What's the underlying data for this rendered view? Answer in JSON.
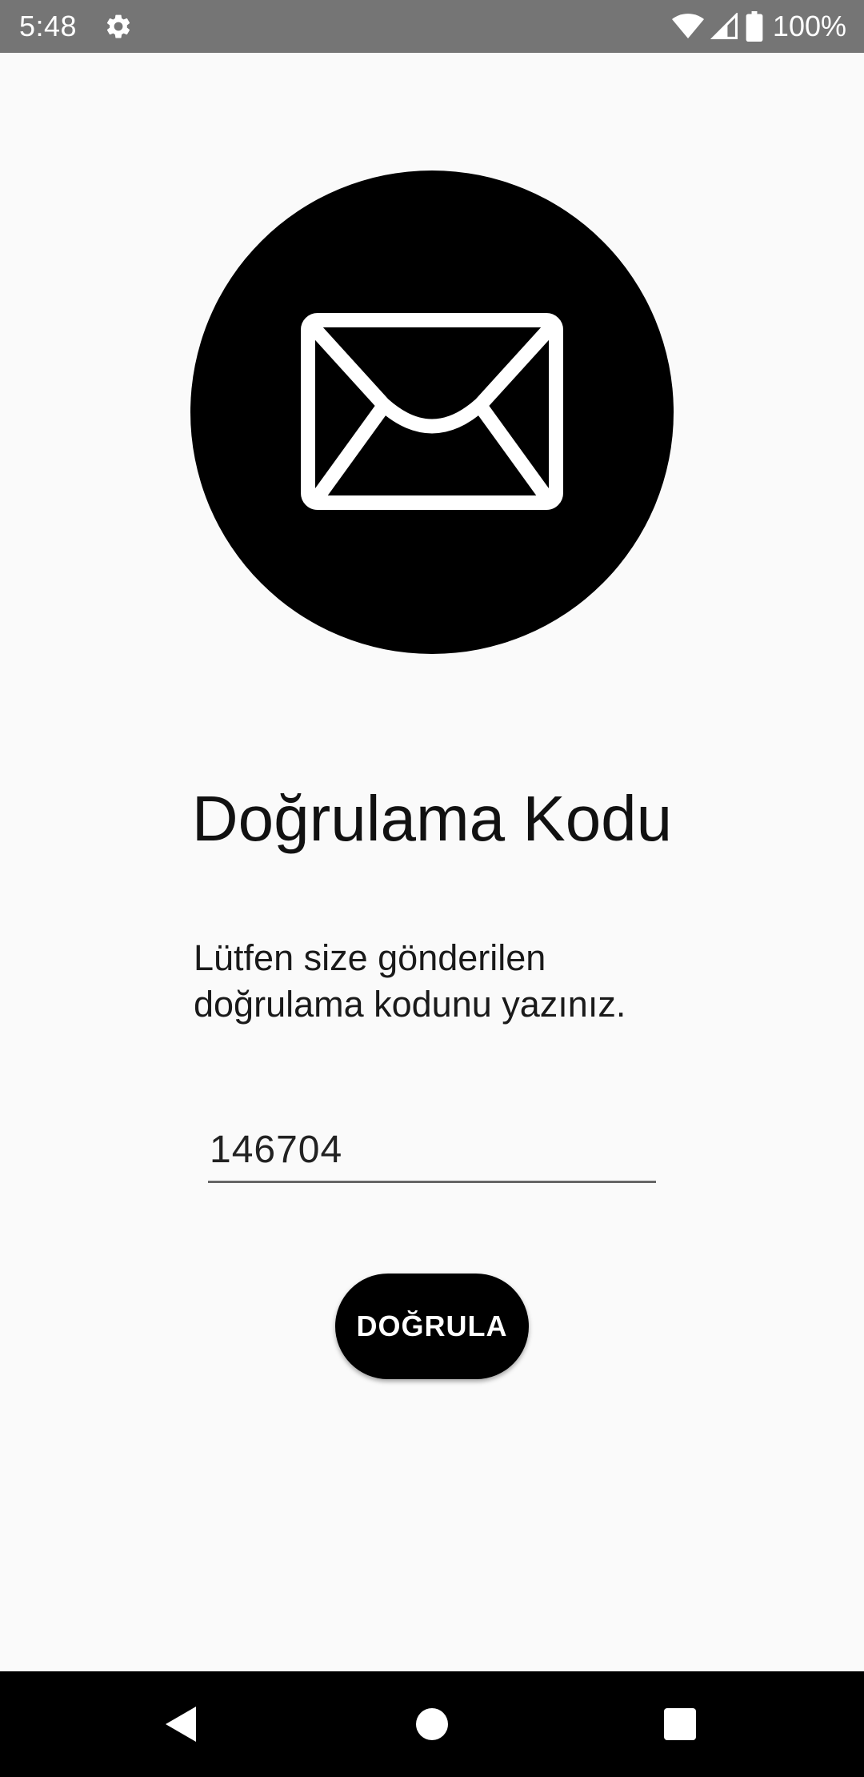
{
  "status_bar": {
    "time": "5:48",
    "battery_percent": "100%",
    "icons": [
      "gear-icon",
      "wifi-icon",
      "cell-signal-icon",
      "battery-icon"
    ],
    "background": "#757575"
  },
  "main": {
    "hero_icon": "envelope-icon",
    "title": "Doğrulama Kodu",
    "instructions_line1": "Lütfen size gönderilen",
    "instructions_line2": "doğrulama kodunu yazınız.",
    "code_value": "146704",
    "verify_label": "DOĞRULA"
  },
  "nav_bar": {
    "buttons": [
      "back-icon",
      "home-icon",
      "recents-icon"
    ]
  },
  "colors": {
    "background": "#fafafa",
    "accent": "#000000",
    "text": "#111111"
  }
}
